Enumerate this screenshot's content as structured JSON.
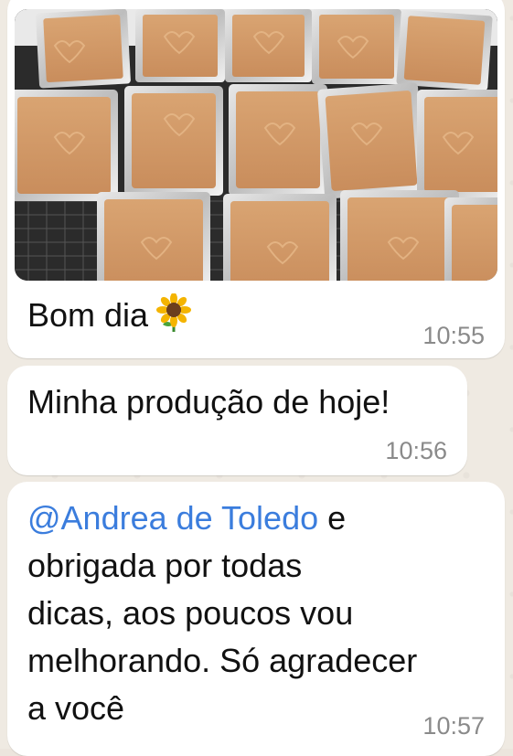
{
  "messages": [
    {
      "type": "image",
      "caption": "Bom dia",
      "caption_emoji": "sunflower-icon",
      "time": "10:55"
    },
    {
      "type": "text",
      "text": "Minha produção de hoje!",
      "time": "10:56"
    },
    {
      "type": "text",
      "mention": "@Andrea de Toledo",
      "mention_color": "#3b7ddd",
      "lines": [
        " e",
        "obrigada por todas",
        "dicas, aos poucos vou",
        "melhorando. Só agradecer",
        "a você"
      ],
      "time": "10:57"
    }
  ],
  "colors": {
    "bubble": "#ffffff",
    "wallpaper": "#efeae2",
    "timestamp": "#8a8a8a"
  }
}
